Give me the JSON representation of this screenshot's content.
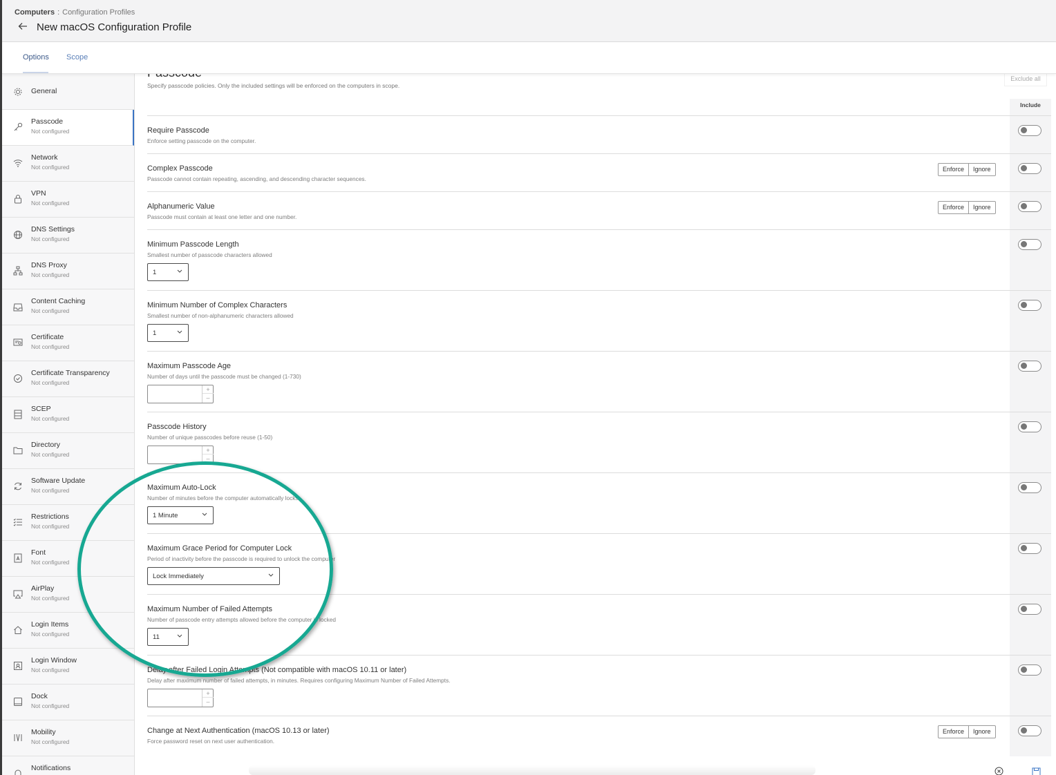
{
  "header": {
    "breadcrumb_root": "Computers",
    "breadcrumb_sep": ":",
    "breadcrumb_current": "Configuration Profiles",
    "back_icon": "arrow-left-icon",
    "title": "New macOS Configuration Profile"
  },
  "tabs": [
    {
      "label": "Options",
      "active": true
    },
    {
      "label": "Scope",
      "active": false
    }
  ],
  "sidebar": {
    "items": [
      {
        "label": "General",
        "status": "",
        "icon": "gear-icon",
        "active": false
      },
      {
        "label": "Passcode",
        "status": "Not configured",
        "icon": "key-icon",
        "active": true
      },
      {
        "label": "Network",
        "status": "Not configured",
        "icon": "wifi-icon",
        "active": false
      },
      {
        "label": "VPN",
        "status": "Not configured",
        "icon": "lock-icon",
        "active": false
      },
      {
        "label": "DNS Settings",
        "status": "Not configured",
        "icon": "globe-icon",
        "active": false
      },
      {
        "label": "DNS Proxy",
        "status": "Not configured",
        "icon": "network-tree-icon",
        "active": false
      },
      {
        "label": "Content Caching",
        "status": "Not configured",
        "icon": "inbox-icon",
        "active": false
      },
      {
        "label": "Certificate",
        "status": "Not configured",
        "icon": "certificate-icon",
        "active": false
      },
      {
        "label": "Certificate Transparency",
        "status": "Not configured",
        "icon": "check-circle-icon",
        "active": false
      },
      {
        "label": "SCEP",
        "status": "Not configured",
        "icon": "server-icon",
        "active": false
      },
      {
        "label": "Directory",
        "status": "Not configured",
        "icon": "folder-icon",
        "active": false
      },
      {
        "label": "Software Update",
        "status": "Not configured",
        "icon": "refresh-icon",
        "active": false
      },
      {
        "label": "Restrictions",
        "status": "Not configured",
        "icon": "checklist-icon",
        "active": false
      },
      {
        "label": "Font",
        "status": "Not configured",
        "icon": "font-file-icon",
        "active": false
      },
      {
        "label": "AirPlay",
        "status": "Not configured",
        "icon": "airplay-icon",
        "active": false
      },
      {
        "label": "Login Items",
        "status": "Not configured",
        "icon": "home-icon",
        "active": false
      },
      {
        "label": "Login Window",
        "status": "Not configured",
        "icon": "window-user-icon",
        "active": false
      },
      {
        "label": "Dock",
        "status": "Not configured",
        "icon": "dock-icon",
        "active": false
      },
      {
        "label": "Mobility",
        "status": "Not configured",
        "icon": "mobility-icon",
        "active": false
      },
      {
        "label": "Notifications",
        "status": "",
        "icon": "bell-icon",
        "active": false
      }
    ]
  },
  "main": {
    "section_title": "Passcode",
    "section_desc": "Specify passcode policies. Only the included settings will be enforced on the computers in scope.",
    "exclude_all": "Exclude all",
    "include_header": "Include",
    "enforce_label": "Enforce",
    "ignore_label": "Ignore",
    "settings": [
      {
        "title": "Require Passcode",
        "desc": "Enforce setting passcode on the computer.",
        "control": "none",
        "included": false
      },
      {
        "title": "Complex Passcode",
        "desc": "Passcode cannot contain repeating, ascending, and descending character sequences.",
        "control": "enforce-ignore",
        "included": false
      },
      {
        "title": "Alphanumeric Value",
        "desc": "Passcode must contain at least one letter and one number.",
        "control": "enforce-ignore",
        "included": false
      },
      {
        "title": "Minimum Passcode Length",
        "desc": "Smallest number of passcode characters allowed",
        "control": "select",
        "value": "1",
        "included": false
      },
      {
        "title": "Minimum Number of Complex Characters",
        "desc": "Smallest number of non-alphanumeric characters allowed",
        "control": "select",
        "value": "1",
        "included": false
      },
      {
        "title": "Maximum Passcode Age",
        "desc": "Number of days until the passcode must be changed (1-730)",
        "control": "stepper",
        "value": "",
        "included": false
      },
      {
        "title": "Passcode History",
        "desc": "Number of unique passcodes before reuse (1-50)",
        "control": "stepper",
        "value": "",
        "included": false
      },
      {
        "title": "Maximum Auto-Lock",
        "desc": "Number of minutes before the computer automatically locks",
        "control": "select",
        "value": "1 Minute",
        "included": false
      },
      {
        "title": "Maximum Grace Period for Computer Lock",
        "desc": "Period of inactivity before the passcode is required to unlock the computer",
        "control": "select",
        "value": "Lock Immediately",
        "included": false
      },
      {
        "title": "Maximum Number of Failed Attempts",
        "desc": "Number of passcode entry attempts allowed before the computer is locked",
        "control": "select",
        "value": "11",
        "included": false
      },
      {
        "title": "Delay after Failed Login Attempts (Not compatible with macOS 10.11 or later)",
        "desc": "Delay after maximum number of failed attempts, in minutes. Requires configuring Maximum Number of Failed Attempts.",
        "control": "stepper",
        "value": "",
        "included": false
      },
      {
        "title": "Change at Next Authentication (macOS 10.13 or later)",
        "desc": "Force password reset on next user authentication.",
        "control": "enforce-ignore",
        "included": false
      }
    ]
  },
  "footer": {
    "cancel_icon": "close-circle-icon",
    "save_icon": "save-icon"
  },
  "colors": {
    "accent": "#3a74c4",
    "annotation": "#17a892"
  }
}
